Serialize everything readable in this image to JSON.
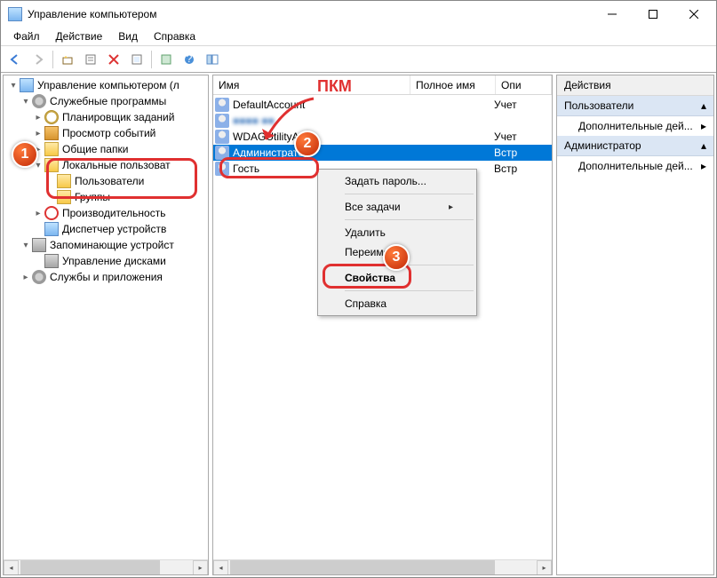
{
  "window": {
    "title": "Управление компьютером"
  },
  "menubar": {
    "file": "Файл",
    "action": "Действие",
    "view": "Вид",
    "help": "Справка"
  },
  "tree": {
    "root": "Управление компьютером (л",
    "services": "Служебные программы",
    "scheduler": "Планировщик заданий",
    "eventviewer": "Просмотр событий",
    "sharedfolders": "Общие папки",
    "localusers": "Локальные пользоват",
    "users": "Пользователи",
    "groups": "Группы",
    "performance": "Производительность",
    "devmgr": "Диспетчер устройств",
    "storage": "Запоминающие устройст",
    "diskmgmt": "Управление дисками",
    "svcapps": "Службы и приложения"
  },
  "columns": {
    "name": "Имя",
    "fullname": "Полное имя",
    "desc": "Опи"
  },
  "users_list": {
    "r0": {
      "name": "DefaultAccount",
      "desc": "Учет"
    },
    "r1": {
      "name": "■■■■ ■■",
      "desc": ""
    },
    "r2": {
      "name": "WDAGUtilityAcc…",
      "desc": "Учет"
    },
    "r3": {
      "name": "Администратор",
      "desc": "Встр"
    },
    "r4": {
      "name": "Гость",
      "desc": "Встр"
    }
  },
  "context_menu": {
    "setpwd": "Задать пароль...",
    "alltasks": "Все задачи",
    "delete": "Удалить",
    "rename": "Переименов",
    "properties": "Свойства",
    "help": "Справка"
  },
  "actions": {
    "header": "Действия",
    "section1": "Пользователи",
    "item1": "Дополнительные дей...",
    "section2": "Администратор",
    "item2": "Дополнительные дей..."
  },
  "annotation": {
    "rmb": "ПКМ",
    "c1": "1",
    "c2": "2",
    "c3": "3"
  }
}
